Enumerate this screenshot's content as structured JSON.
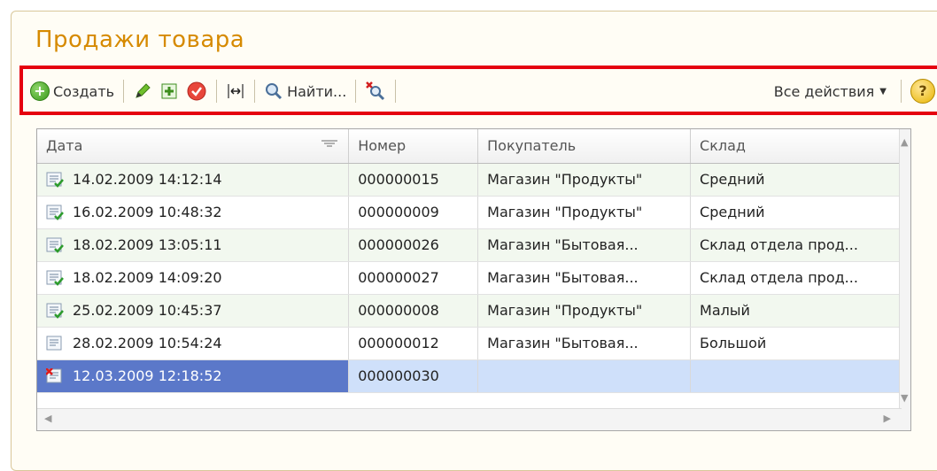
{
  "window": {
    "title": "Продажи товара"
  },
  "toolbar": {
    "create_label": "Создать",
    "find_label": "Найти...",
    "all_actions_label": "Все действия",
    "help_label": "?",
    "highlight_color": "#e5000f"
  },
  "table": {
    "columns": [
      "Дата",
      "Номер",
      "Покупатель",
      "Склад"
    ],
    "rows": [
      {
        "date": "14.02.2009 14:12:14",
        "number": "000000015",
        "buyer": "Магазин \"Продукты\"",
        "warehouse": "Средний",
        "icon": "posted-doc-icon"
      },
      {
        "date": "16.02.2009 10:48:32",
        "number": "000000009",
        "buyer": "Магазин \"Продукты\"",
        "warehouse": "Средний",
        "icon": "posted-doc-icon"
      },
      {
        "date": "18.02.2009 13:05:11",
        "number": "000000026",
        "buyer": "Магазин \"Бытовая...",
        "warehouse": "Склад отдела прод...",
        "icon": "posted-doc-icon"
      },
      {
        "date": "18.02.2009 14:09:20",
        "number": "000000027",
        "buyer": "Магазин \"Бытовая...",
        "warehouse": "Склад отдела прод...",
        "icon": "posted-doc-icon"
      },
      {
        "date": "25.02.2009 10:45:37",
        "number": "000000008",
        "buyer": "Магазин \"Продукты\"",
        "warehouse": "Малый",
        "icon": "posted-doc-icon"
      },
      {
        "date": "28.02.2009 10:54:24",
        "number": "000000012",
        "buyer": "Магазин \"Бытовая...",
        "warehouse": "Большой",
        "icon": "doc-icon"
      },
      {
        "date": "12.03.2009 12:18:52",
        "number": "000000030",
        "buyer": "",
        "warehouse": "",
        "icon": "deleted-doc-icon"
      }
    ]
  }
}
